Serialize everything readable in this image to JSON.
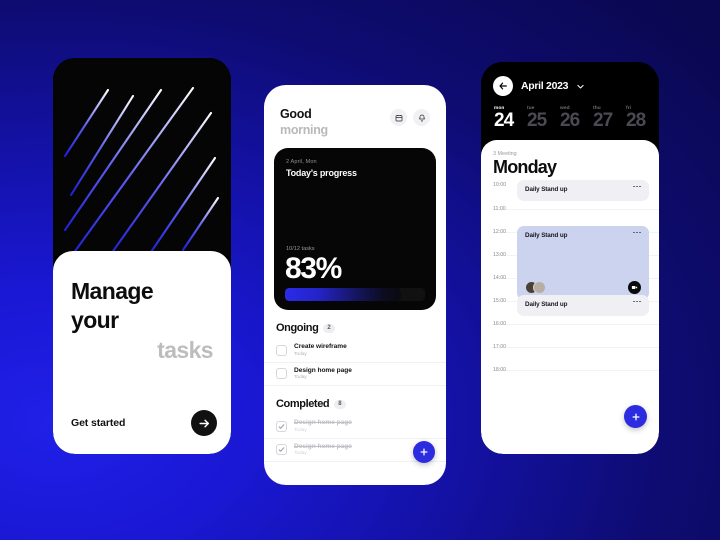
{
  "screen_onboarding": {
    "hero_icon": "diagonal-stripes-pattern",
    "title_line1": "Manage",
    "title_line2": "your",
    "title_line3": "tasks",
    "cta_label": "Get started",
    "cta_icon": "arrow-right-icon"
  },
  "screen_home": {
    "greeting_line1": "Good",
    "greeting_line2": "morning",
    "calendar_icon": "calendar-icon",
    "bell_icon": "bell-icon",
    "progress_card": {
      "date": "2 April, Mon",
      "title": "Today's progress",
      "tasks_count": "10/12 tasks",
      "percent": "83%",
      "percent_value": 83
    },
    "sections": [
      {
        "label": "Ongoing",
        "count": "2",
        "tasks": [
          {
            "name": "Create wireframe",
            "sub": "Today",
            "done": false
          },
          {
            "name": "Design home page",
            "sub": "Today",
            "done": false
          }
        ]
      },
      {
        "label": "Completed",
        "count": "8",
        "tasks": [
          {
            "name": "Design home page",
            "sub": "Today",
            "done": true
          },
          {
            "name": "Design home page",
            "sub": "Today",
            "done": true
          }
        ]
      }
    ],
    "fab_icon": "plus-icon"
  },
  "screen_calendar": {
    "back_icon": "arrow-left-icon",
    "month": "April 2023",
    "month_chevron_icon": "chevron-down-icon",
    "days": [
      {
        "dow": "mon",
        "num": "24",
        "active": true
      },
      {
        "dow": "tue",
        "num": "25",
        "active": false
      },
      {
        "dow": "wed",
        "num": "26",
        "active": false
      },
      {
        "dow": "thu",
        "num": "27",
        "active": false
      },
      {
        "dow": "fri",
        "num": "28",
        "active": false
      }
    ],
    "meeting_count": "3 Meeting",
    "day_name": "Monday",
    "times": [
      "10:00",
      "11:00",
      "12:00",
      "13:00",
      "14:00",
      "15:00",
      "16:00",
      "17:00",
      "18:00"
    ],
    "events": [
      {
        "title": "Daily Stand up",
        "style": "grey",
        "menu_icon": "more-horizontal-icon"
      },
      {
        "title": "Daily Stand up",
        "style": "blue",
        "menu_icon": "more-horizontal-icon",
        "video_icon": "video-camera-icon"
      },
      {
        "title": "Daily Stand up",
        "style": "grey",
        "menu_icon": "more-horizontal-icon"
      }
    ],
    "fab_icon": "plus-icon"
  },
  "theme": {
    "background_blue": "#1a18d4",
    "background_navy": "#0a0850",
    "accent_blue": "#2b2be0",
    "dark": "#060606",
    "event_blue": "#ccd3ef",
    "event_grey": "#f0f0f4"
  }
}
